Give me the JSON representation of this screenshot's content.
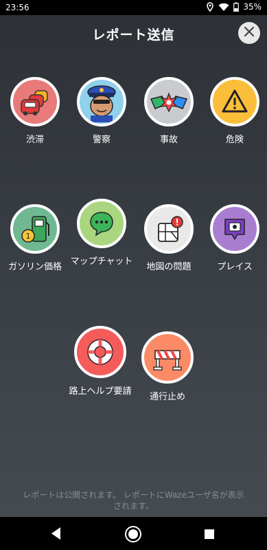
{
  "status_bar": {
    "time": "23:56",
    "battery": "35%",
    "icons": [
      "location-icon",
      "wifi-icon",
      "battery-icon"
    ]
  },
  "header": {
    "title": "レポート送信",
    "close_icon": "close-icon"
  },
  "reports": [
    {
      "label": "渋滞",
      "icon": "traffic-jam-icon",
      "color": "#e87a7a"
    },
    {
      "label": "警察",
      "icon": "police-icon",
      "color": "#8fd0ea"
    },
    {
      "label": "事故",
      "icon": "crash-icon",
      "color": "#c9cbcf"
    },
    {
      "label": "危険",
      "icon": "hazard-icon",
      "color": "#fbbe3a"
    },
    {
      "label": "ガソリン価格",
      "icon": "gas-price-icon",
      "color": "#6fb892"
    },
    {
      "label": "マップチャット",
      "icon": "map-chat-icon",
      "color": "#a9d67f"
    },
    {
      "label": "地図の問題",
      "icon": "map-issue-icon",
      "color": "#e9e9e9"
    },
    {
      "label": "プレイス",
      "icon": "place-icon",
      "color": "#a97ed1"
    },
    {
      "label": "路上ヘルプ要請",
      "icon": "roadside-help-icon",
      "color": "#f55b5b"
    },
    {
      "label": "通行止め",
      "icon": "closure-icon",
      "color": "#fb8a67"
    }
  ],
  "footer": {
    "line1": "レポートは公開されます。 レポートにWazeユーザ名が表示",
    "line2": "されます。"
  },
  "nav_bar": {
    "buttons": [
      "back-icon",
      "home-icon",
      "recents-icon"
    ]
  }
}
